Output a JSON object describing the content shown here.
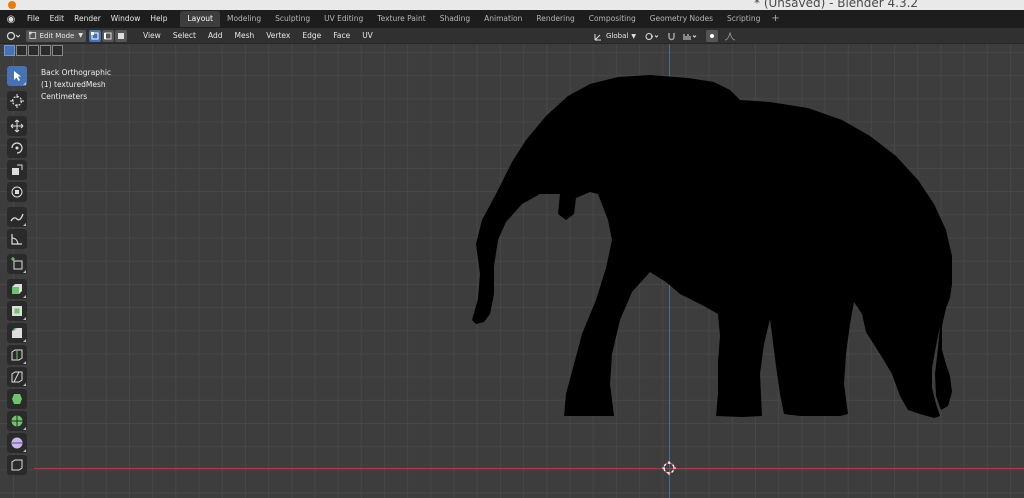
{
  "window": {
    "title": "* (Unsaved) - Blender 4.3.2"
  },
  "menu": [
    "File",
    "Edit",
    "Render",
    "Window",
    "Help"
  ],
  "workspaces": [
    {
      "label": "Layout",
      "active": true
    },
    {
      "label": "Modeling",
      "active": false
    },
    {
      "label": "Sculpting",
      "active": false
    },
    {
      "label": "UV Editing",
      "active": false
    },
    {
      "label": "Texture Paint",
      "active": false
    },
    {
      "label": "Shading",
      "active": false
    },
    {
      "label": "Animation",
      "active": false
    },
    {
      "label": "Rendering",
      "active": false
    },
    {
      "label": "Compositing",
      "active": false
    },
    {
      "label": "Geometry Nodes",
      "active": false
    },
    {
      "label": "Scripting",
      "active": false
    }
  ],
  "header": {
    "mode": "Edit Mode",
    "menus": [
      "View",
      "Select",
      "Add",
      "Mesh",
      "Vertex",
      "Edge",
      "Face",
      "UV"
    ],
    "transform_orientation": "Global"
  },
  "viewport": {
    "view_name": "Back Orthographic",
    "object_info": "(1) texturedMesh",
    "units": "Centimeters"
  },
  "toolbar": [
    {
      "name": "select-box-tool",
      "icon": "cursor-arrow-icon",
      "active": true
    },
    {
      "name": "cursor-tool",
      "icon": "3d-cursor-icon",
      "active": false
    },
    {
      "name": "move-tool",
      "icon": "move-arrows-icon",
      "active": false
    },
    {
      "name": "rotate-tool",
      "icon": "rotate-icon",
      "active": false
    },
    {
      "name": "scale-tool",
      "icon": "scale-icon",
      "active": false
    },
    {
      "name": "transform-tool",
      "icon": "transform-icon",
      "active": false
    },
    {
      "name": "annotate-tool",
      "icon": "pencil-icon",
      "active": false
    },
    {
      "name": "measure-tool",
      "icon": "ruler-icon",
      "active": false
    },
    {
      "name": "add-cube-tool",
      "icon": "add-cube-icon",
      "active": false
    },
    {
      "name": "extrude-tool",
      "icon": "extrude-icon",
      "active": false
    },
    {
      "name": "inset-tool",
      "icon": "inset-icon",
      "active": false
    },
    {
      "name": "bevel-tool",
      "icon": "bevel-icon",
      "active": false
    },
    {
      "name": "loop-cut-tool",
      "icon": "loop-cut-icon",
      "active": false
    },
    {
      "name": "knife-tool",
      "icon": "knife-icon",
      "active": false
    },
    {
      "name": "poly-build-tool",
      "icon": "poly-build-icon",
      "active": false
    },
    {
      "name": "spin-tool",
      "icon": "spin-icon",
      "active": false
    },
    {
      "name": "smooth-tool",
      "icon": "smooth-icon",
      "active": false
    },
    {
      "name": "shear-tool",
      "icon": "shear-icon",
      "active": false
    }
  ],
  "colors": {
    "accent": "#4772b3",
    "x_axis": "#a3414b",
    "z_axis": "#3f6da0",
    "viewport_bg": "#3d3d3d",
    "mesh": "#000000"
  }
}
